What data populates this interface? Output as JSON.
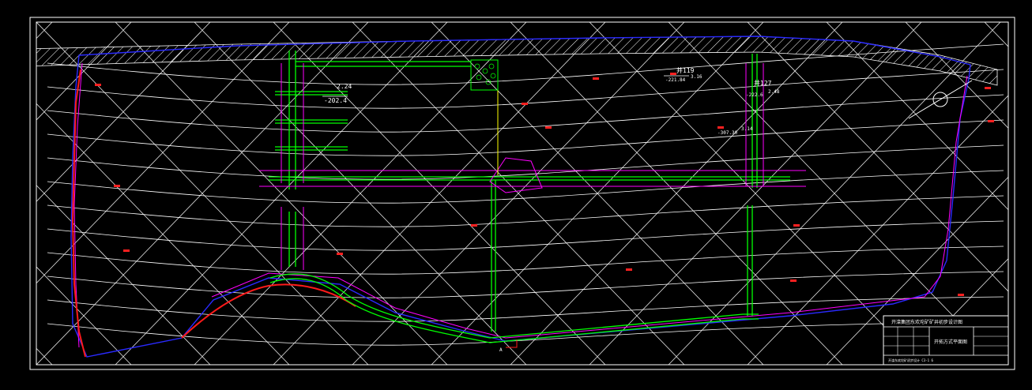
{
  "drawing": {
    "labels": {
      "w119": "井119",
      "w119_val1": "3.16",
      "w119_val2": "-221.84",
      "wl1_val1": "2.24",
      "wl1_val2": "-202.4",
      "w127": "井127",
      "w127_val1": "2.48",
      "w127_val2": "-222.6",
      "w3_val1": "3.14",
      "w3_val2": "-307.30",
      "mark_a": "A"
    },
    "title_block": {
      "main_title": "开滦集团东欢坨矿矿井初步设计图",
      "drawing_name": "开拓方式平面图",
      "footer_text": "开滦东欢坨矿初步设计 C3-1 6",
      "small_cells": [
        "",
        "",
        "",
        "",
        "",
        ""
      ]
    },
    "colors": {
      "background": "#000000",
      "frame": "#ffffff",
      "contour": "#ffffff",
      "boundary": "#2020ff",
      "roadway": "#00ff00",
      "magenta_line": "#ff00ff",
      "fault": "#ff0000",
      "yellow": "#ffff00"
    }
  }
}
